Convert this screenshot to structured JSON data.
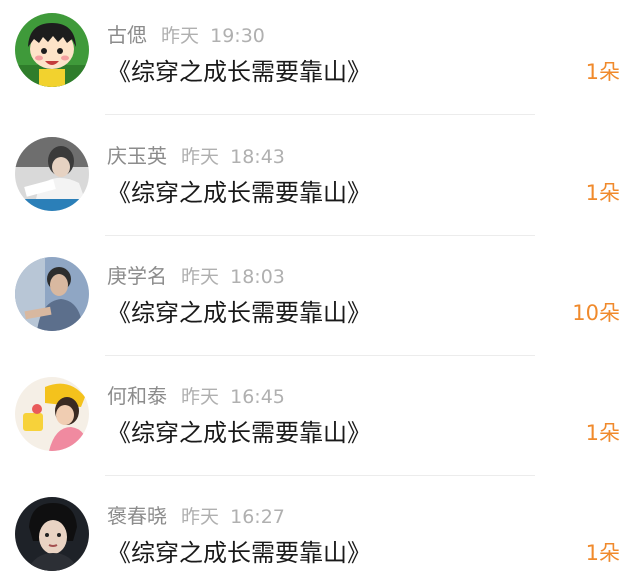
{
  "messages": [
    {
      "name": "古偲",
      "date": "昨天",
      "time": "19:30",
      "title": "《综穿之成长需要靠山》",
      "amount": "1朵",
      "avatar_icon": "cartoon-girl-avatar"
    },
    {
      "name": "庆玉英",
      "date": "昨天",
      "time": "18:43",
      "title": "《综穿之成长需要靠山》",
      "amount": "1朵",
      "avatar_icon": "reading-person-avatar"
    },
    {
      "name": "庚学名",
      "date": "昨天",
      "time": "18:03",
      "title": "《综穿之成长需要靠山》",
      "amount": "10朵",
      "avatar_icon": "young-man-avatar"
    },
    {
      "name": "何和泰",
      "date": "昨天",
      "time": "16:45",
      "title": "《综穿之成长需要靠山》",
      "amount": "1朵",
      "avatar_icon": "yellow-hat-girl-avatar"
    },
    {
      "name": "褒春晓",
      "date": "昨天",
      "time": "16:27",
      "title": "《综穿之成长需要靠山》",
      "amount": "1朵",
      "avatar_icon": "portrait-avatar"
    }
  ],
  "colors": {
    "amount": "#f08a2c",
    "name": "#8c8c8c",
    "time": "#b0b0b0",
    "title": "#1a1a1a"
  }
}
